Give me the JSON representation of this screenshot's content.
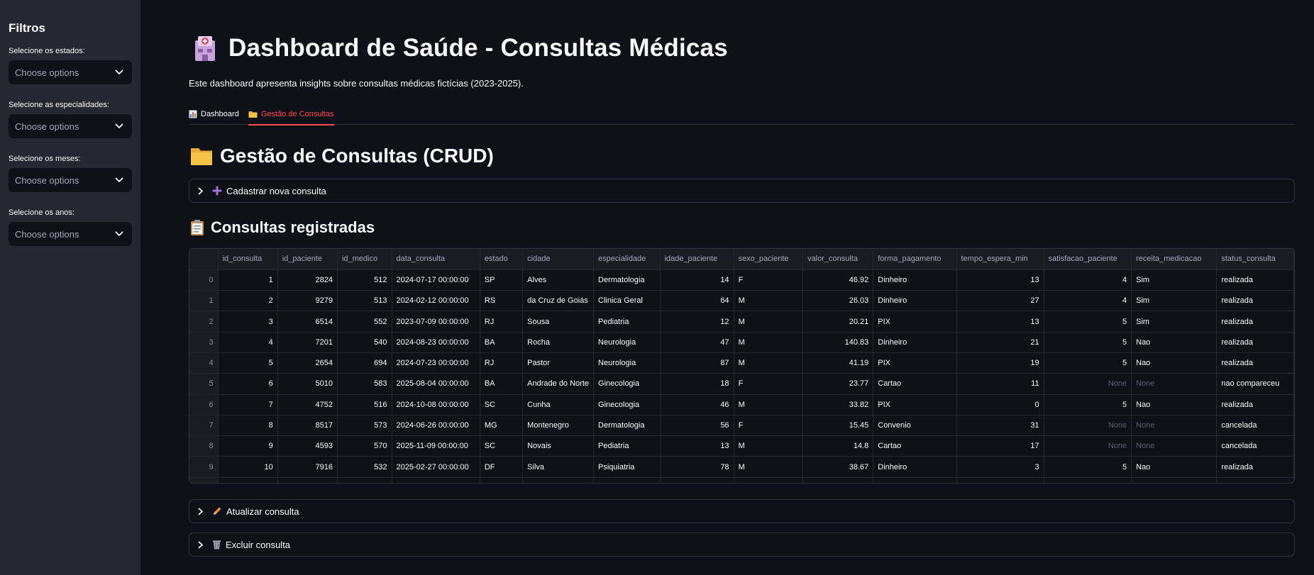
{
  "sidebar": {
    "title": "Filtros",
    "filters": [
      {
        "label": "Selecione os estados:",
        "placeholder": "Choose options"
      },
      {
        "label": "Selecione as especialidades:",
        "placeholder": "Choose options"
      },
      {
        "label": "Selecione os meses:",
        "placeholder": "Choose options"
      },
      {
        "label": "Selecione os anos:",
        "placeholder": "Choose options"
      }
    ]
  },
  "header": {
    "title": "Dashboard de Saúde - Consultas Médicas",
    "subtitle": "Este dashboard apresenta insights sobre consultas médicas fictícias (2023-2025)."
  },
  "tabs": [
    {
      "label": "Dashboard",
      "icon": "bar-chart-icon",
      "active": false
    },
    {
      "label": "Gestão de Consultas",
      "icon": "folder-icon",
      "active": true
    }
  ],
  "crud": {
    "title": "Gestão de Consultas (CRUD)",
    "create_label": "Cadastrar nova consulta",
    "list_title": "Consultas registradas",
    "update_label": "Atualizar consulta",
    "delete_label": "Excluir consulta"
  },
  "table": {
    "columns": [
      "",
      "id_consulta",
      "id_paciente",
      "id_medico",
      "data_consulta",
      "estado",
      "cidade",
      "especialidade",
      "idade_paciente",
      "sexo_paciente",
      "valor_consulta",
      "forma_pagamento",
      "tempo_espera_min",
      "satisfacao_paciente",
      "receita_medicacao",
      "status_consulta"
    ],
    "rows": [
      [
        "0",
        "1",
        "2824",
        "512",
        "2024-07-17 00:00:00",
        "SP",
        "Alves",
        "Dermatologia",
        "14",
        "F",
        "46.92",
        "Dinheiro",
        "13",
        "4",
        "Sim",
        "realizada"
      ],
      [
        "1",
        "2",
        "9279",
        "513",
        "2024-02-12 00:00:00",
        "RS",
        "da Cruz de Goiás",
        "Clinica Geral",
        "64",
        "M",
        "26.03",
        "Dinheiro",
        "27",
        "4",
        "Sim",
        "realizada"
      ],
      [
        "2",
        "3",
        "6514",
        "552",
        "2023-07-09 00:00:00",
        "RJ",
        "Sousa",
        "Pediatria",
        "12",
        "M",
        "20.21",
        "PIX",
        "13",
        "5",
        "Sim",
        "realizada"
      ],
      [
        "3",
        "4",
        "7201",
        "540",
        "2024-08-23 00:00:00",
        "BA",
        "Rocha",
        "Neurologia",
        "47",
        "M",
        "140.83",
        "Dinheiro",
        "21",
        "5",
        "Nao",
        "realizada"
      ],
      [
        "4",
        "5",
        "2654",
        "694",
        "2024-07-23 00:00:00",
        "RJ",
        "Pastor",
        "Neurologia",
        "87",
        "M",
        "41.19",
        "PIX",
        "19",
        "5",
        "Nao",
        "realizada"
      ],
      [
        "5",
        "6",
        "5010",
        "583",
        "2025-08-04 00:00:00",
        "BA",
        "Andrade do Norte",
        "Ginecologia",
        "18",
        "F",
        "23.77",
        "Cartao",
        "11",
        "None",
        "None",
        "nao compareceu"
      ],
      [
        "6",
        "7",
        "4752",
        "516",
        "2024-10-08 00:00:00",
        "SC",
        "Cunha",
        "Ginecologia",
        "46",
        "M",
        "33.82",
        "PIX",
        "0",
        "5",
        "Nao",
        "realizada"
      ],
      [
        "7",
        "8",
        "8517",
        "573",
        "2024-06-26 00:00:00",
        "MG",
        "Montenegro",
        "Dermatologia",
        "56",
        "F",
        "15.45",
        "Convenio",
        "31",
        "None",
        "None",
        "cancelada"
      ],
      [
        "8",
        "9",
        "4593",
        "570",
        "2025-11-09 00:00:00",
        "SC",
        "Novais",
        "Pediatria",
        "13",
        "M",
        "14.8",
        "Cartao",
        "17",
        "None",
        "None",
        "cancelada"
      ],
      [
        "9",
        "10",
        "7916",
        "532",
        "2025-02-27 00:00:00",
        "DF",
        "Silva",
        "Psiquiatria",
        "78",
        "M",
        "38.67",
        "Dinheiro",
        "3",
        "5",
        "Nao",
        "realizada"
      ]
    ]
  },
  "colors": {
    "background": "#0e1117",
    "sidebar": "#262730",
    "accent": "#ff4b4b",
    "border": "#31333f"
  }
}
